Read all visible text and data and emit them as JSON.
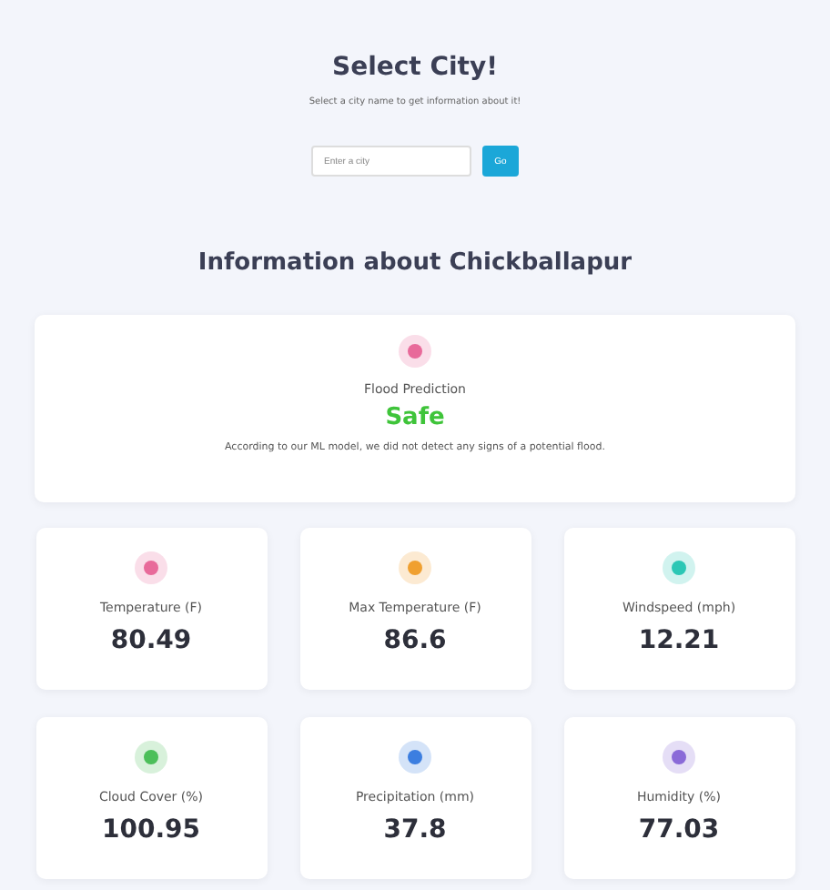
{
  "header": {
    "title": "Select City!",
    "subtitle": "Select a city name to get information about it!"
  },
  "search": {
    "placeholder": "Enter a city",
    "button": "Go"
  },
  "heading": "Information about Chickballapur",
  "flood": {
    "label": "Flood Prediction",
    "status": "Safe",
    "color": "#e86a9a",
    "description": "According to our ML model, we did not detect any signs of a potential flood."
  },
  "stats": [
    {
      "label": "Temperature (F)",
      "value": "80.49",
      "color": "#e86a9a"
    },
    {
      "label": "Max Temperature (F)",
      "value": "86.6",
      "color": "#f0a030"
    },
    {
      "label": "Windspeed (mph)",
      "value": "12.21",
      "color": "#2cc7b5"
    },
    {
      "label": "Cloud Cover (%)",
      "value": "100.95",
      "color": "#4cbf5a"
    },
    {
      "label": "Precipitation (mm)",
      "value": "37.8",
      "color": "#3c7ee0"
    },
    {
      "label": "Humidity (%)",
      "value": "77.03",
      "color": "#8a6ad8"
    }
  ]
}
